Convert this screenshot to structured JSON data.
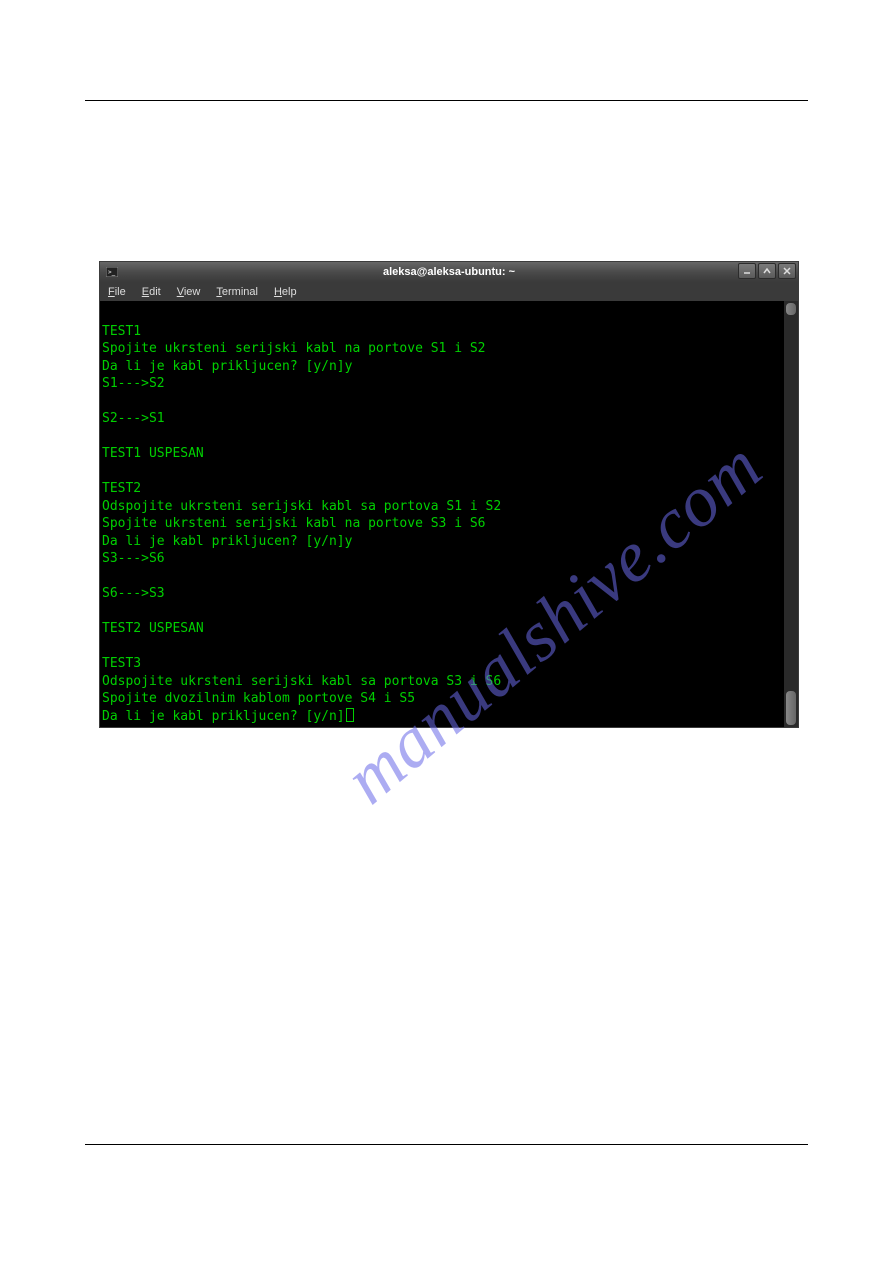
{
  "watermark": "manualshive.com",
  "window": {
    "title": "aleksa@aleksa-ubuntu: ~",
    "menus": {
      "file": {
        "underlined": "F",
        "rest": "ile"
      },
      "edit": {
        "underlined": "E",
        "rest": "dit"
      },
      "view": {
        "underlined": "V",
        "rest": "iew"
      },
      "terminal": {
        "underlined": "T",
        "rest": "erminal"
      },
      "help": {
        "underlined": "H",
        "rest": "elp"
      }
    }
  },
  "terminal": {
    "lines": [
      "",
      "TEST1",
      "Spojite ukrsteni serijski kabl na portove S1 i S2",
      "Da li je kabl prikljucen? [y/n]y",
      "S1--->S2",
      "",
      "S2--->S1",
      "",
      "TEST1 USPESAN",
      "",
      "TEST2",
      "Odspojite ukrsteni serijski kabl sa portova S1 i S2",
      "Spojite ukrsteni serijski kabl na portove S3 i S6",
      "Da li je kabl prikljucen? [y/n]y",
      "S3--->S6",
      "",
      "S6--->S3",
      "",
      "TEST2 USPESAN",
      "",
      "TEST3",
      "Odspojite ukrsteni serijski kabl sa portova S3 i S6",
      "Spojite dvozilnim kablom portove S4 i S5"
    ],
    "prompt_line": "Da li je kabl prikljucen? [y/n]"
  }
}
